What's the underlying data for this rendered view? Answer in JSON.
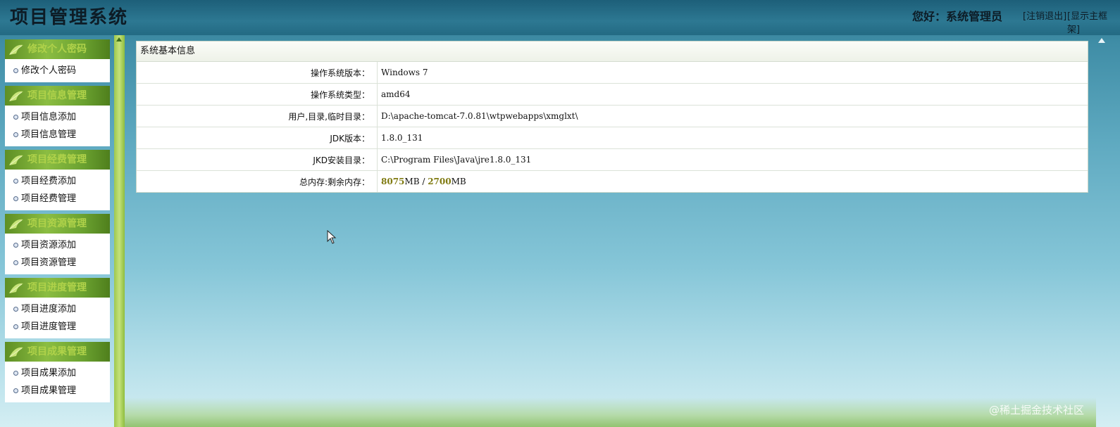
{
  "header": {
    "app_title": "项目管理系统",
    "greeting": "您好：系统管理员",
    "logout_label": "[注销退出]",
    "show_frame_label": "[显示主框架]"
  },
  "sidebar": {
    "groups": [
      {
        "title": "修改个人密码",
        "items": [
          "修改个人密码"
        ]
      },
      {
        "title": "项目信息管理",
        "items": [
          "项目信息添加",
          "项目信息管理"
        ]
      },
      {
        "title": "项目经费管理",
        "items": [
          "项目经费添加",
          "项目经费管理"
        ]
      },
      {
        "title": "项目资源管理",
        "items": [
          "项目资源添加",
          "项目资源管理"
        ]
      },
      {
        "title": "项目进度管理",
        "items": [
          "项目进度添加",
          "项目进度管理"
        ]
      },
      {
        "title": "项目成果管理",
        "items": [
          "项目成果添加",
          "项目成果管理"
        ]
      }
    ]
  },
  "panel": {
    "title": "系统基本信息",
    "rows": [
      {
        "label": "操作系统版本：",
        "value": "Windows 7"
      },
      {
        "label": "操作系统类型：",
        "value": "amd64"
      },
      {
        "label": "用户,目录,临时目录：",
        "value": "D:\\apache-tomcat-7.0.81\\wtpwebapps\\xmglxt\\"
      },
      {
        "label": "JDK版本：",
        "value": "1.8.0_131"
      },
      {
        "label": "JKD安装目录：",
        "value": "C:\\Program Files\\Java\\jre1.8.0_131"
      }
    ],
    "memory": {
      "label": "总内存:剩余内存：",
      "total": "8075",
      "total_unit": "MB",
      "separator": " / ",
      "free": "2700",
      "free_unit": "MB"
    }
  },
  "watermark": "@稀土掘金技术社区",
  "icons": {
    "leaf": "leaf-icon",
    "bullet": "bullet-icon",
    "cursor": "mouse-cursor-icon"
  }
}
